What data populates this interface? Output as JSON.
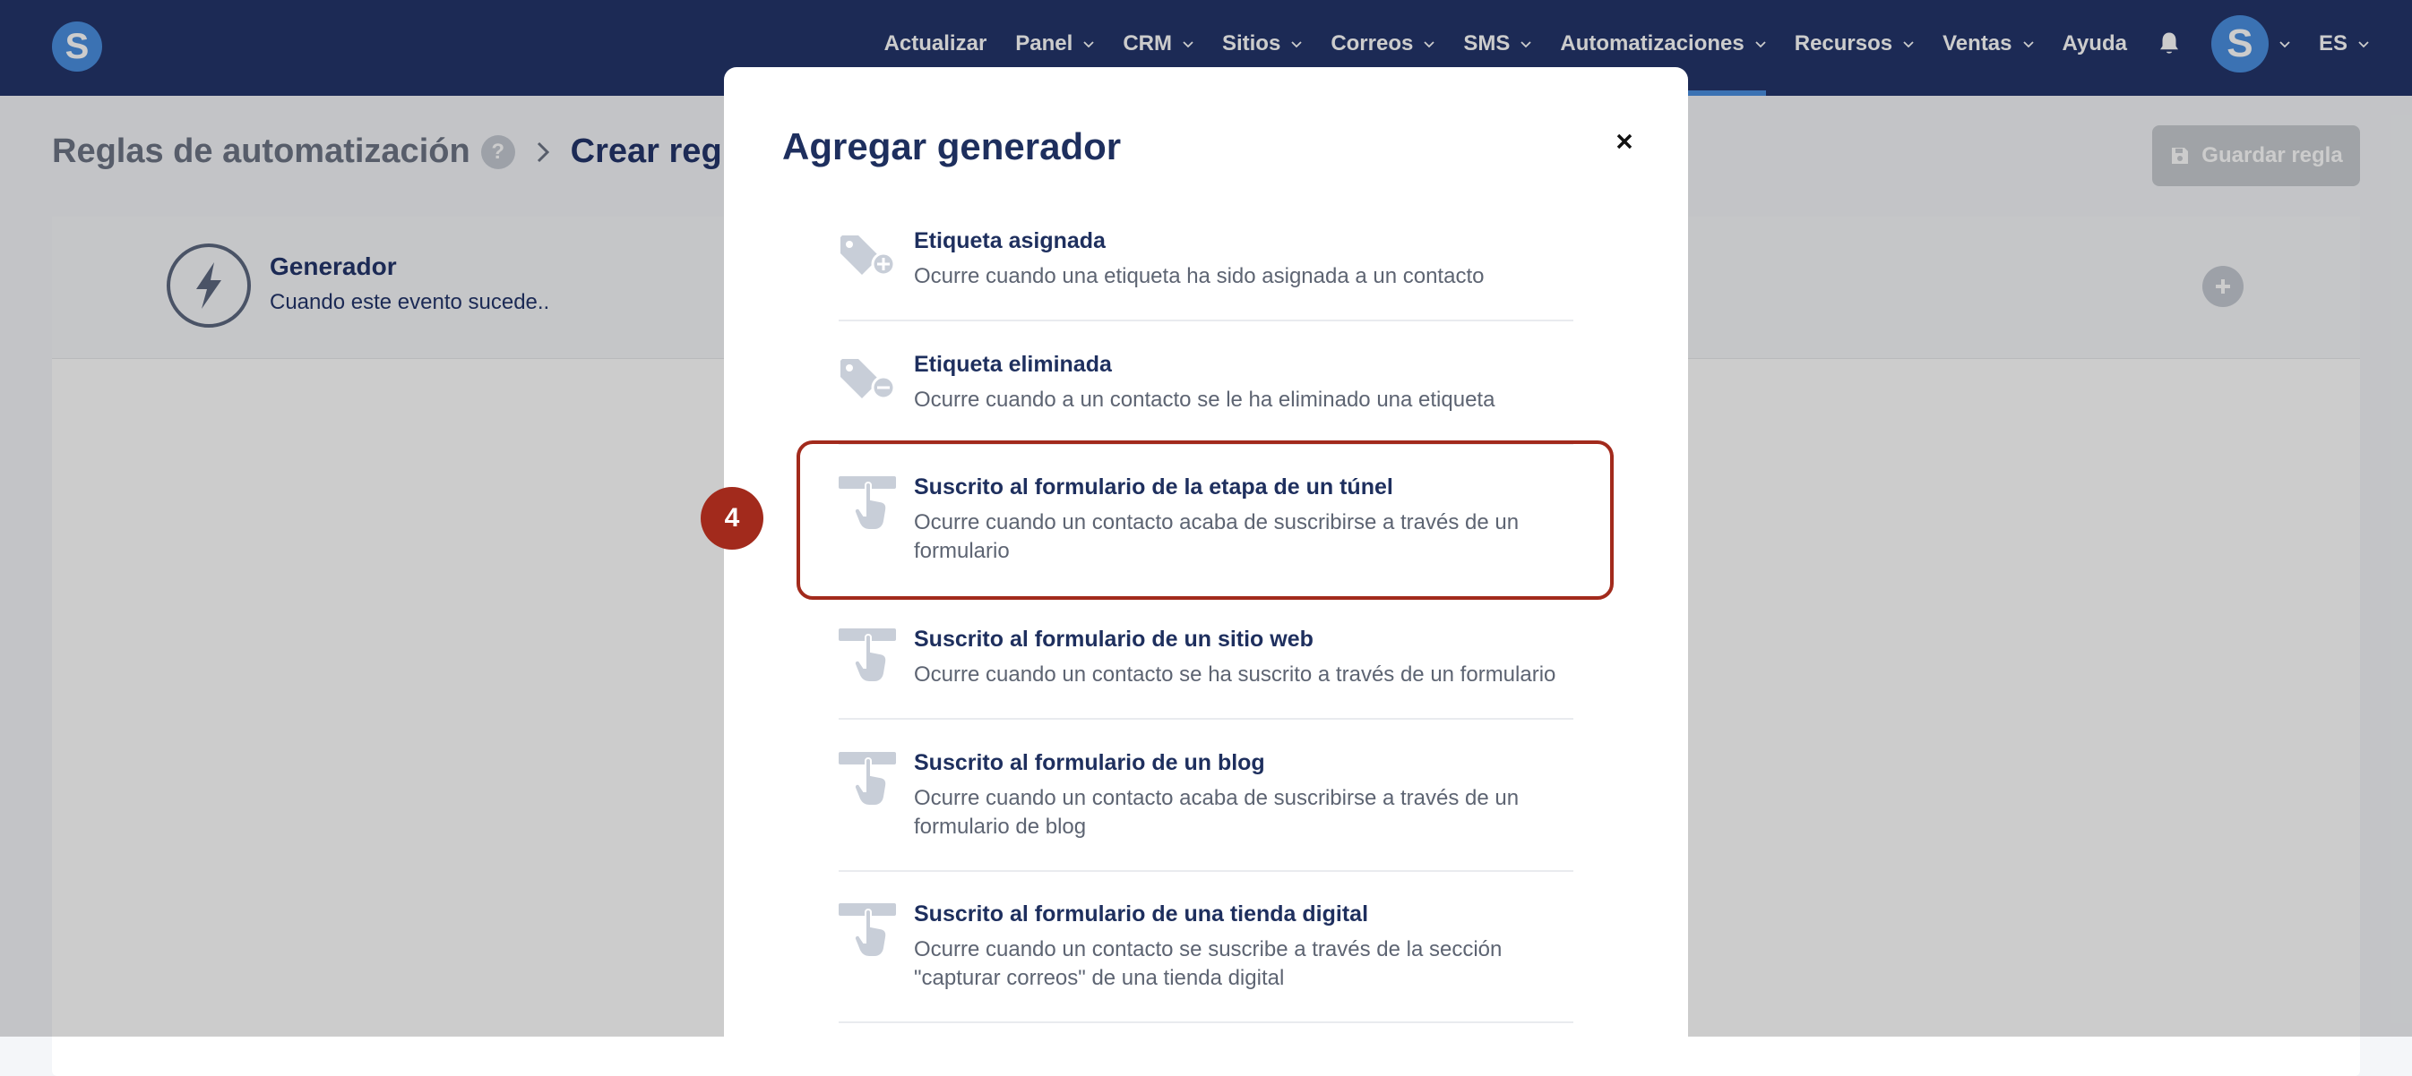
{
  "brand": {
    "logo_letter": "S",
    "avatar_letter": "S",
    "accent": "#4a8fe0",
    "nav_bg": "#23356b",
    "highlight": "#a22a1c"
  },
  "nav": {
    "items": [
      {
        "label": "Actualizar",
        "dropdown": false
      },
      {
        "label": "Panel",
        "dropdown": true
      },
      {
        "label": "CRM",
        "dropdown": true
      },
      {
        "label": "Sitios",
        "dropdown": true
      },
      {
        "label": "Correos",
        "dropdown": true
      },
      {
        "label": "SMS",
        "dropdown": true
      },
      {
        "label": "Automatizaciones",
        "dropdown": true,
        "active": true
      },
      {
        "label": "Recursos",
        "dropdown": true
      },
      {
        "label": "Ventas",
        "dropdown": true
      },
      {
        "label": "Ayuda",
        "dropdown": false
      }
    ],
    "language": "ES"
  },
  "page": {
    "breadcrumb_root": "Reglas de automatización",
    "help_badge": "?",
    "breadcrumb_current": "Crear regla d",
    "save_button": "Guardar regla"
  },
  "generator_card": {
    "title": "Generador",
    "subtitle": "Cuando este evento sucede.."
  },
  "modal": {
    "title": "Agregar generador",
    "close": "×",
    "options": [
      {
        "title": "Etiqueta asignada",
        "desc": "Ocurre cuando una etiqueta ha sido asignada a un contacto",
        "icon": "tag-plus-icon"
      },
      {
        "title": "Etiqueta eliminada",
        "desc": "Ocurre cuando a un contacto se le ha eliminado una etiqueta",
        "icon": "tag-minus-icon"
      },
      {
        "title": "Suscrito al formulario de la etapa de un túnel",
        "desc": "Ocurre cuando un contacto acaba de suscribirse a través de un formulario",
        "icon": "form-click-icon"
      },
      {
        "title": "Suscrito al formulario de un sitio web",
        "desc": "Ocurre cuando un contacto se ha suscrito a través de un formulario",
        "icon": "form-click-icon"
      },
      {
        "title": "Suscrito al formulario de un blog",
        "desc": "Ocurre cuando un contacto acaba de suscribirse a través de un formulario de blog",
        "icon": "form-click-icon"
      },
      {
        "title": "Suscrito al formulario de una tienda digital",
        "desc": "Ocurre cuando un contacto se suscribe a través de la sección \"capturar correos\" de una tienda digital",
        "icon": "form-click-icon"
      }
    ]
  },
  "annotation": {
    "step_number": "4"
  }
}
